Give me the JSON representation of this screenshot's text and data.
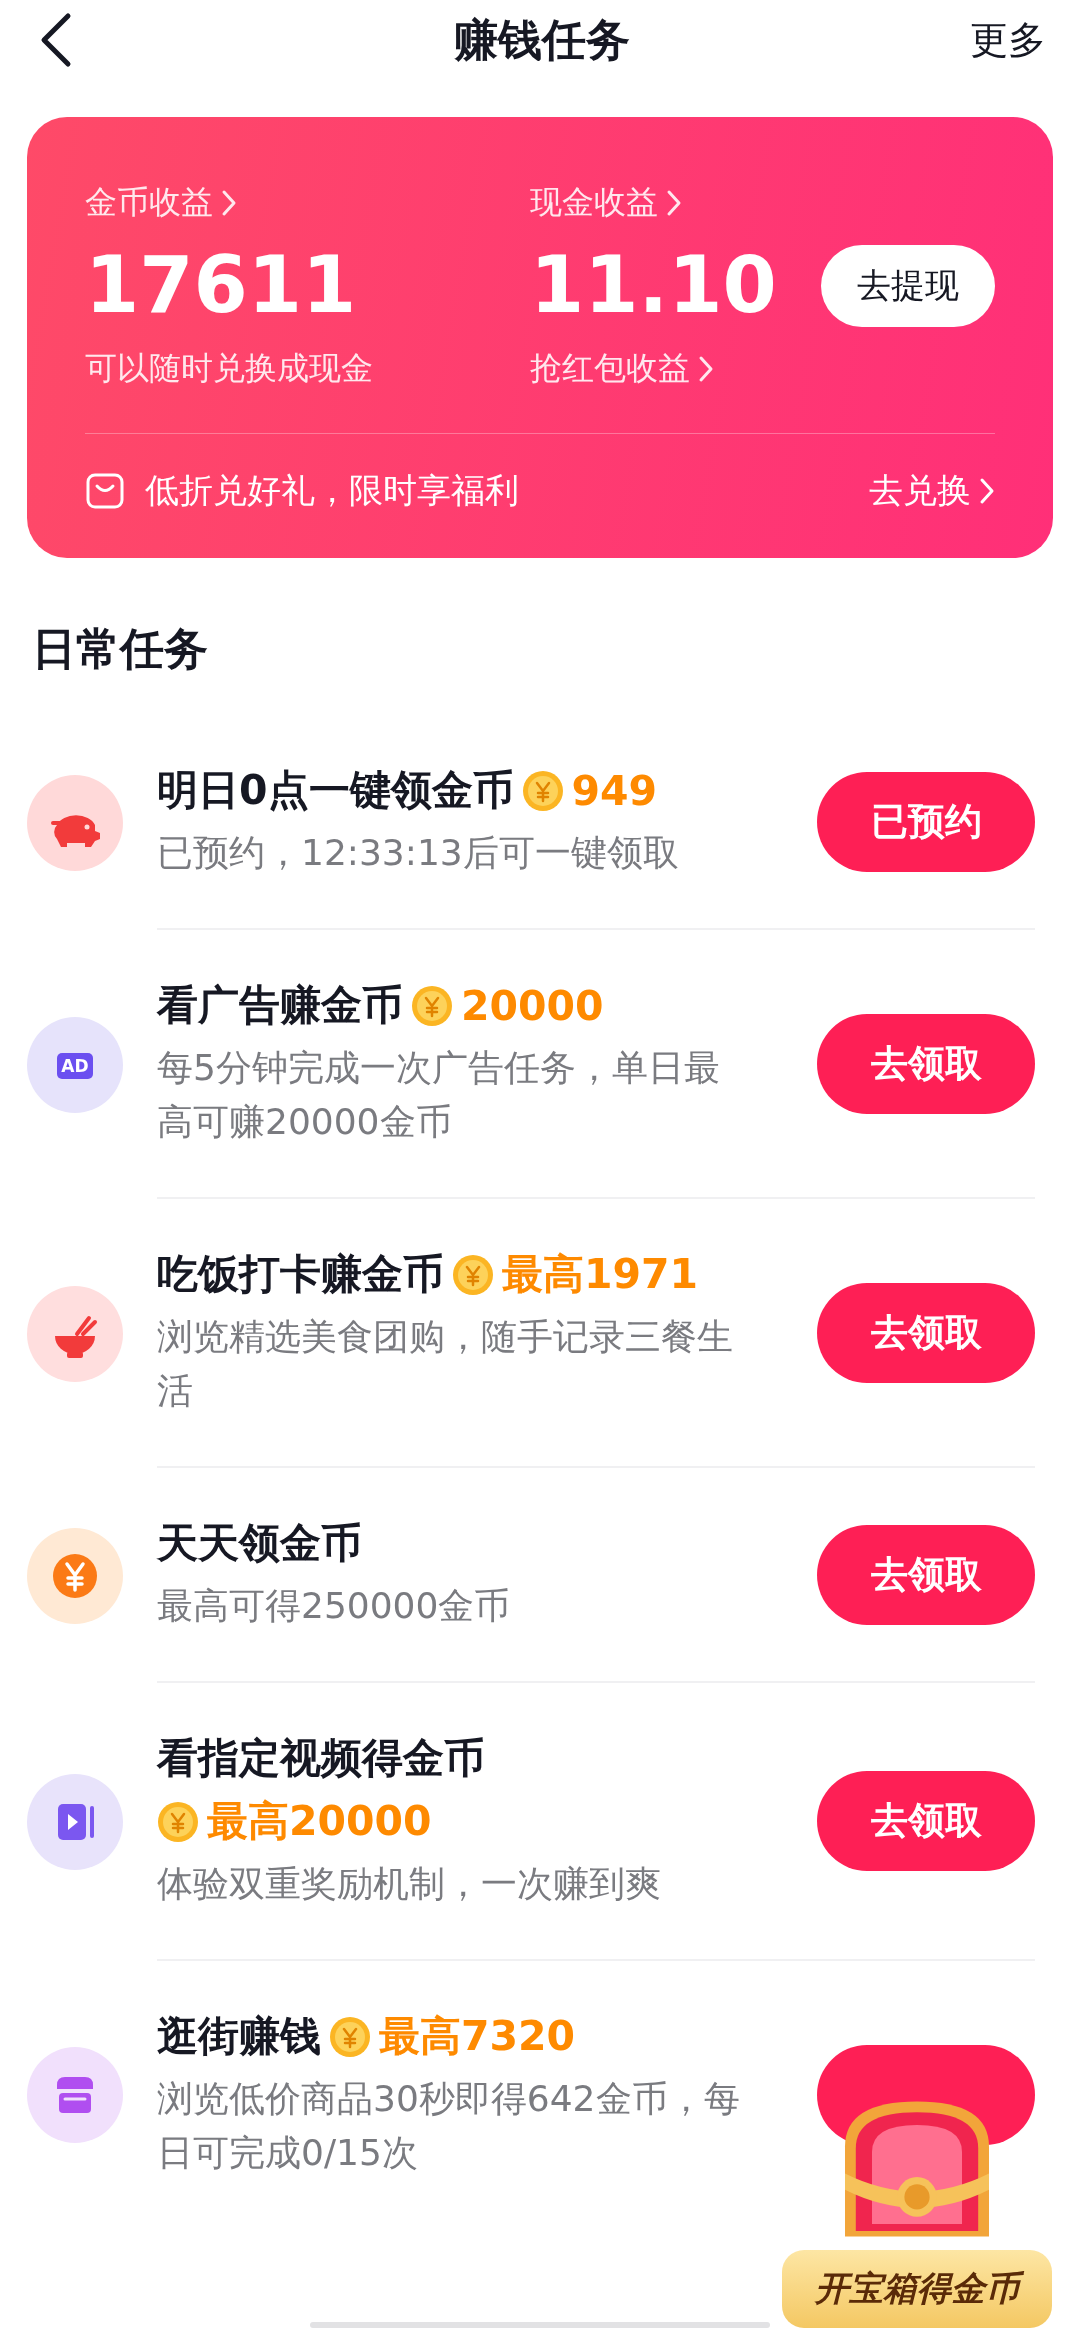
{
  "header": {
    "title": "赚钱任务",
    "more": "更多"
  },
  "earnings": {
    "coins": {
      "label": "金币收益",
      "value": "17611",
      "note": "可以随时兑换成现金"
    },
    "cash": {
      "label": "现金收益",
      "value": "11.10",
      "note": "抢红包收益",
      "button": "去提现"
    },
    "promo": {
      "text": "低折兑好礼，限时享福利",
      "link": "去兑换"
    }
  },
  "section_title": "日常任务",
  "tasks": [
    {
      "kind": "piggy",
      "title": "明日0点一键领金币",
      "reward": "949",
      "reward_below": false,
      "description": "已预约，12:33:13后可一键领取",
      "action": "已预约"
    },
    {
      "kind": "ad",
      "icon_text": "AD",
      "title": "看广告赚金币",
      "reward": "20000",
      "reward_below": false,
      "description": "每5分钟完成一次广告任务，单日最高可赚20000金币",
      "action": "去领取"
    },
    {
      "kind": "bowl",
      "title": "吃饭打卡赚金币",
      "reward": "最高1971",
      "reward_below": false,
      "description": "浏览精选美食团购，随手记录三餐生活",
      "action": "去领取"
    },
    {
      "kind": "yen",
      "title": "天天领金币",
      "description": "最高可得250000金币",
      "action": "去领取"
    },
    {
      "kind": "video",
      "title": "看指定视频得金币",
      "reward": "最高20000",
      "reward_below": true,
      "description": "体验双重奖励机制，一次赚到爽",
      "action": "去领取"
    },
    {
      "kind": "shop",
      "title": "逛街赚钱",
      "reward": "最高7320",
      "reward_below": false,
      "description": "浏览低价商品30秒即得642金币，每日可完成0/15次"
    }
  ],
  "floating_chest": {
    "label": "开宝箱得金币"
  }
}
